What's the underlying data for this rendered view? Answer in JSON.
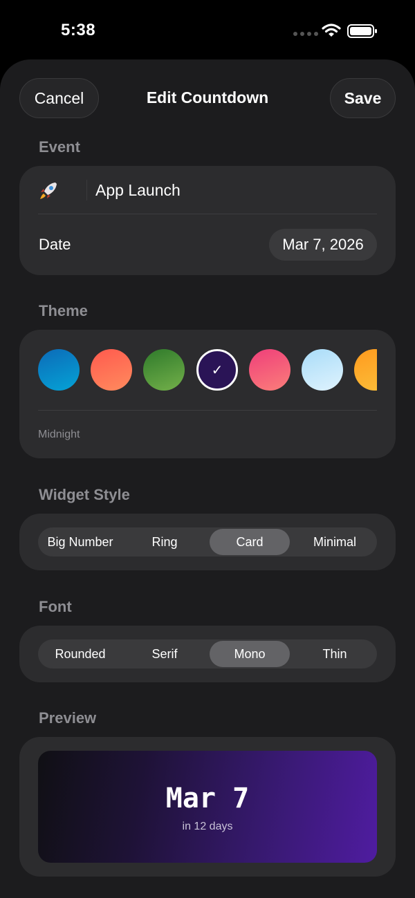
{
  "status_bar": {
    "time": "5:38"
  },
  "nav": {
    "cancel_label": "Cancel",
    "title": "Edit Countdown",
    "save_label": "Save"
  },
  "event": {
    "section_label": "Event",
    "icon": "rocket-icon",
    "name": "App Launch",
    "date_label": "Date",
    "date_value": "Mar 7, 2026"
  },
  "theme": {
    "section_label": "Theme",
    "selected_name": "Midnight",
    "swatches": [
      {
        "icon": "theme-swatch",
        "color": "#0a7fc7",
        "selected": false
      },
      {
        "icon": "theme-swatch",
        "color": "#ff6a55",
        "selected": false
      },
      {
        "icon": "theme-swatch",
        "color": "#4a9a34",
        "selected": false
      },
      {
        "icon": "theme-swatch",
        "color": "#2a1456",
        "selected": true
      },
      {
        "icon": "theme-swatch",
        "color": "#f0527e",
        "selected": false
      },
      {
        "icon": "theme-swatch",
        "color": "#c5e8fb",
        "selected": false
      },
      {
        "icon": "theme-swatch",
        "color": "#f7a427",
        "selected": false
      }
    ]
  },
  "widget_style": {
    "section_label": "Widget Style",
    "options": [
      "Big Number",
      "Ring",
      "Card",
      "Minimal"
    ],
    "selected": "Card"
  },
  "font": {
    "section_label": "Font",
    "options": [
      "Rounded",
      "Serif",
      "Mono",
      "Thin"
    ],
    "selected": "Mono"
  },
  "preview": {
    "section_label": "Preview",
    "date": "Mar 7",
    "subtitle": "in 12 days"
  },
  "colors": {
    "background": "#1c1c1e",
    "card": "#2c2c2e",
    "segment_track": "#3a3a3c",
    "segment_active": "#636366",
    "label_gray": "#8e8e93"
  }
}
